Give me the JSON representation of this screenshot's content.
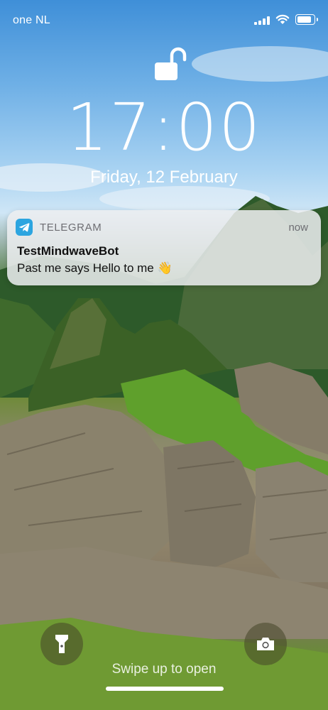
{
  "status_bar": {
    "carrier": "one NL",
    "signal_icon": "cellular-signal-icon",
    "wifi_icon": "wifi-icon",
    "battery_icon": "battery-icon",
    "battery_level": 0.85
  },
  "lock": {
    "icon": "unlocked-padlock-icon"
  },
  "clock": {
    "time": "17:00",
    "date": "Friday, 12 February"
  },
  "notification": {
    "app_icon": "telegram-icon",
    "app_name": "TELEGRAM",
    "time": "now",
    "title": "TestMindwaveBot",
    "body": "Past me says Hello to me 👋"
  },
  "bottom": {
    "flashlight_icon": "flashlight-icon",
    "camera_icon": "camera-icon",
    "swipe_hint": "Swipe up to open"
  }
}
